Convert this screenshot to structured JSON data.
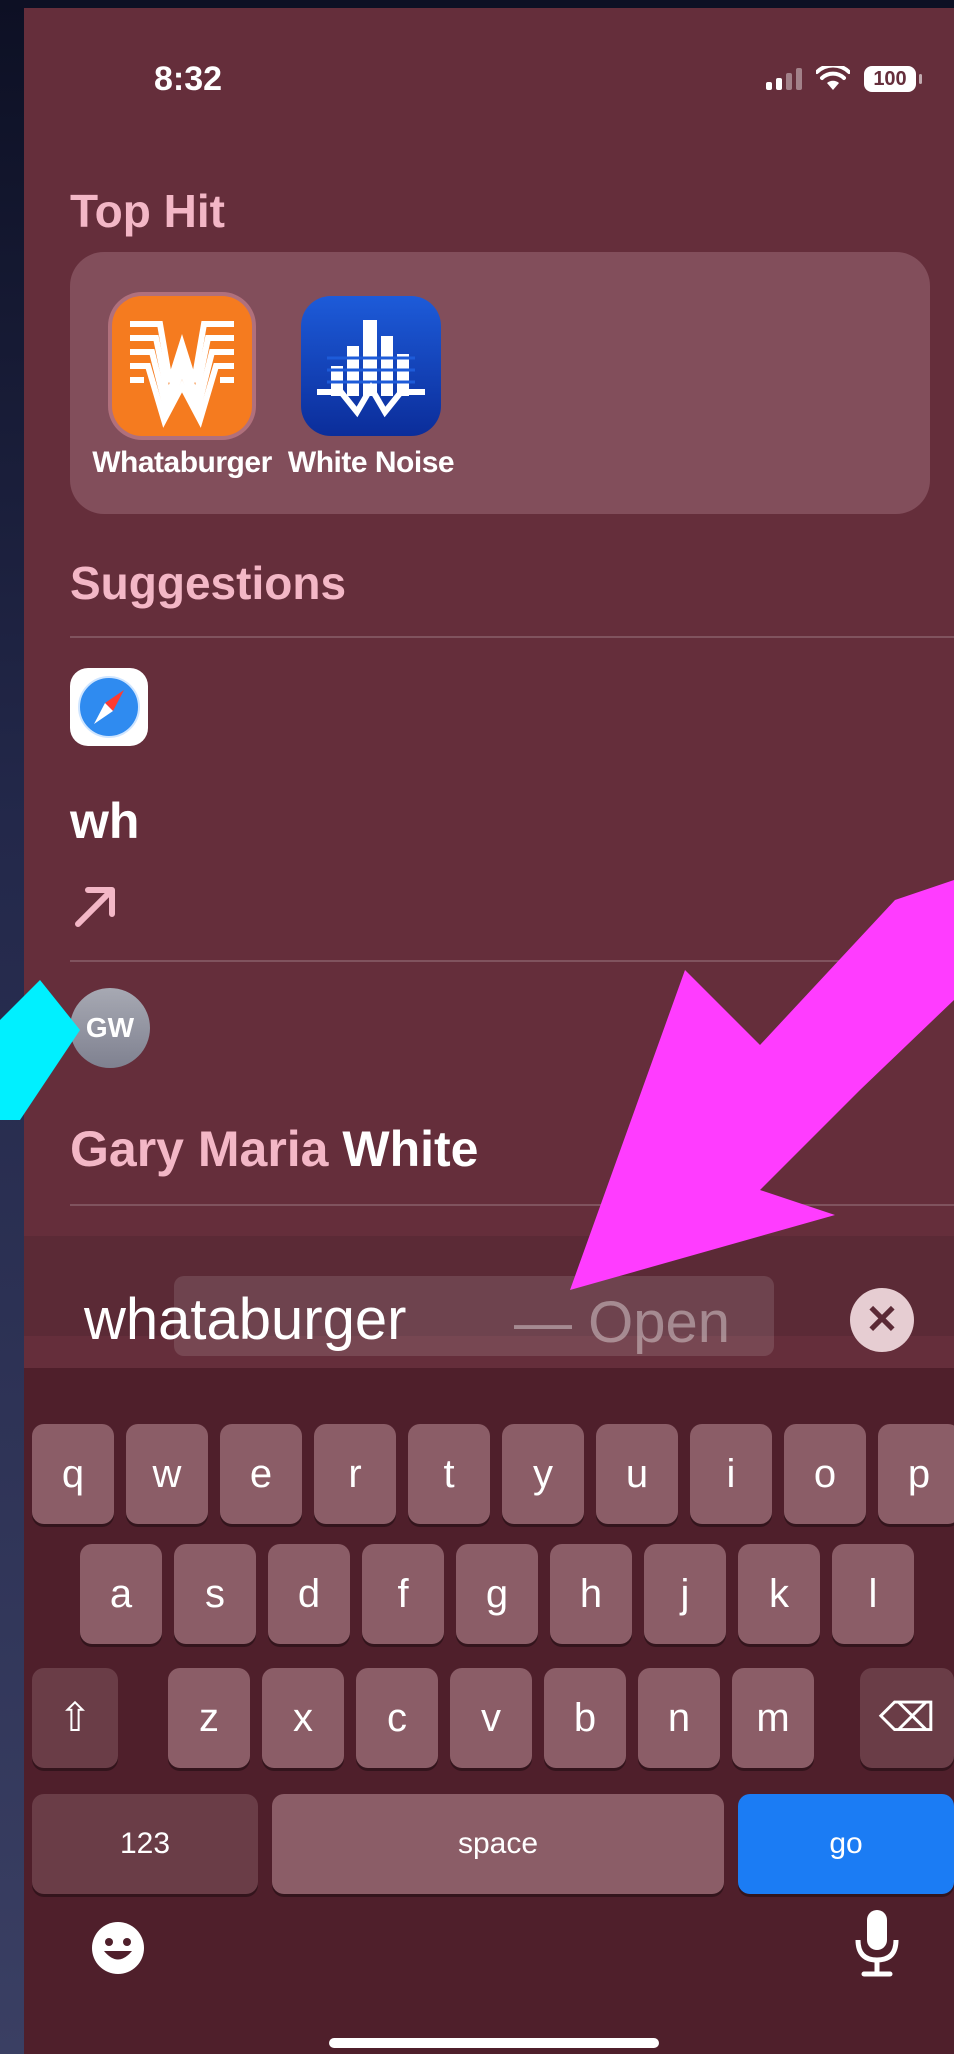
{
  "status_bar": {
    "time": "8:32",
    "battery": "100"
  },
  "top_hit": {
    "title": "Top Hit",
    "apps": [
      {
        "label": "Whataburger",
        "icon": "whataburger-icon"
      },
      {
        "label": "White Noise",
        "icon": "white-noise-icon"
      }
    ]
  },
  "suggestions": {
    "title": "Suggestions",
    "web_query": "wh",
    "contact": {
      "initials": "GW",
      "name_part1": "Gary Maria ",
      "name_part2": "White"
    }
  },
  "search": {
    "text": "whataburger",
    "completion": "— Open"
  },
  "keyboard": {
    "row1": [
      "q",
      "w",
      "e",
      "r",
      "t",
      "y",
      "u",
      "i",
      "o",
      "p"
    ],
    "row2": [
      "a",
      "s",
      "d",
      "f",
      "g",
      "h",
      "j",
      "k",
      "l"
    ],
    "row3": [
      "z",
      "x",
      "c",
      "v",
      "b",
      "n",
      "m"
    ],
    "numbers_label": "123",
    "space_label": "space",
    "go_label": "go"
  },
  "colors": {
    "background": "#652e3b",
    "accent_pink": "#f3b7c6",
    "go_blue": "#1b7cf4",
    "annotation_magenta": "#ff3cff",
    "annotation_cyan": "#00f0ff"
  }
}
